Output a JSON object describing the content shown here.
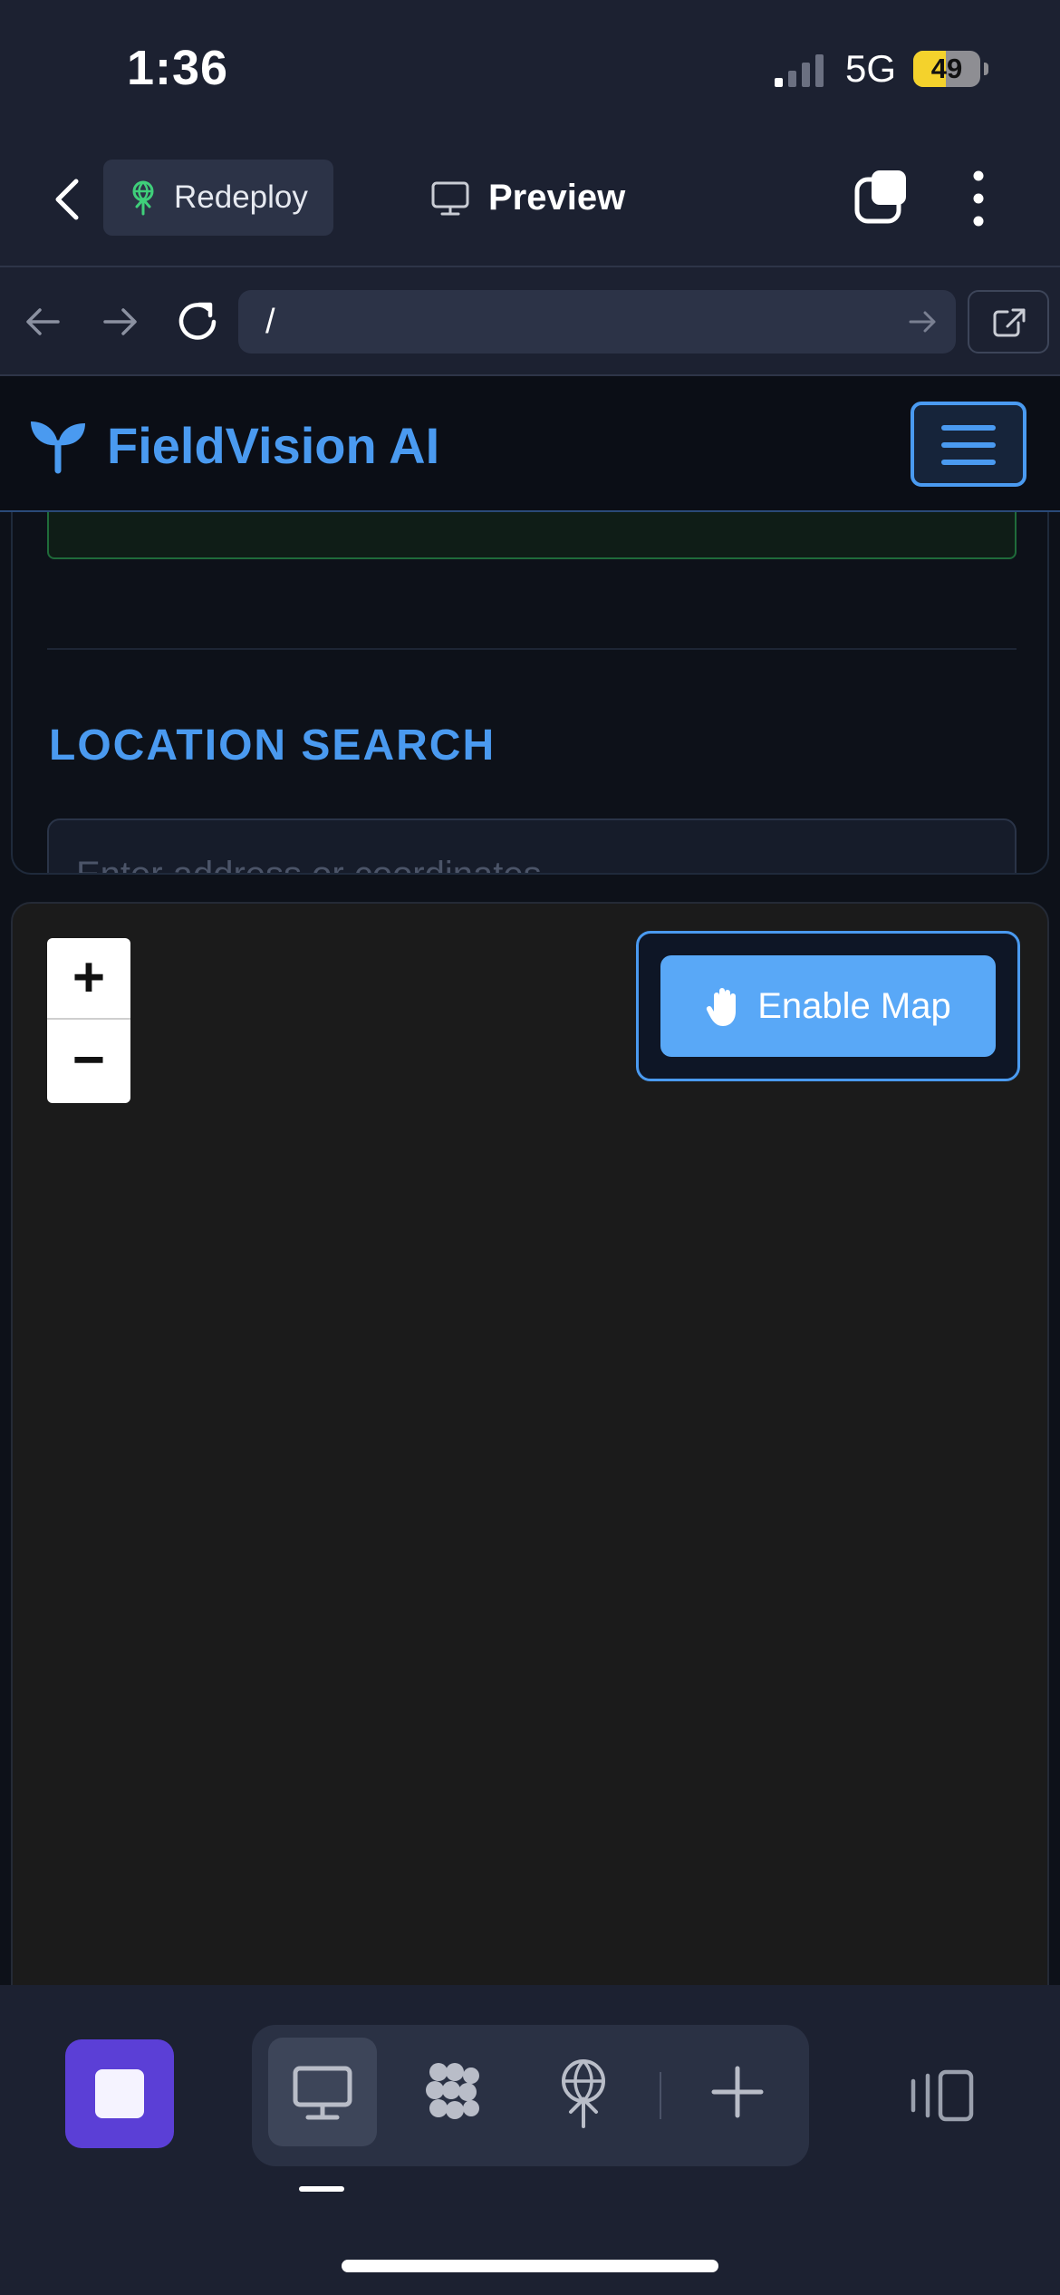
{
  "status_bar": {
    "time": "1:36",
    "network": "5G",
    "battery_level": "49",
    "battery_fraction": 0.49
  },
  "toolbar": {
    "redeploy_label": "Redeploy",
    "preview_label": "Preview"
  },
  "url_bar": {
    "url": "/"
  },
  "app": {
    "brand": "FieldVision AI",
    "section_title": "LOCATION SEARCH",
    "search_placeholder": "Enter address or coordinates"
  },
  "map": {
    "zoom_in": "+",
    "zoom_out": "−",
    "enable_label": "Enable Map"
  },
  "colors": {
    "accent": "#4a9af0",
    "stop_button": "#5b3fd6",
    "background": "#1c2131"
  },
  "icons": {
    "redeploy": "antenna-icon",
    "preview": "monitor-icon",
    "enable_map": "hand-icon",
    "brand": "sprout-icon"
  }
}
